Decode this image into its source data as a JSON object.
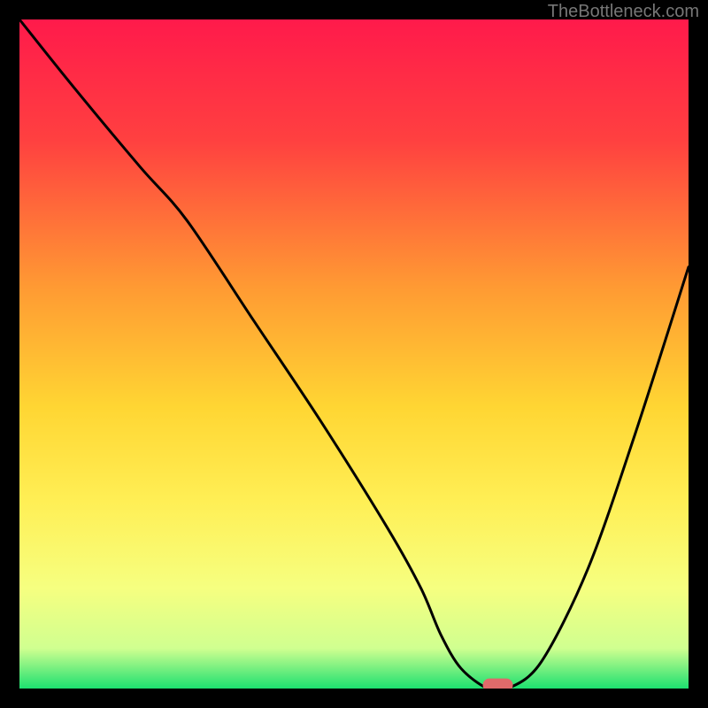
{
  "watermark": "TheBottleneck.com",
  "chart_data": {
    "type": "line",
    "title": "",
    "xlabel": "",
    "ylabel": "",
    "xlim": [
      0,
      100
    ],
    "ylim": [
      0,
      100
    ],
    "background_gradient": {
      "stops": [
        {
          "offset": 0,
          "color": "#ff1a4b"
        },
        {
          "offset": 18,
          "color": "#ff4040"
        },
        {
          "offset": 40,
          "color": "#ff9a33"
        },
        {
          "offset": 58,
          "color": "#ffd633"
        },
        {
          "offset": 72,
          "color": "#ffef55"
        },
        {
          "offset": 85,
          "color": "#f6ff80"
        },
        {
          "offset": 94,
          "color": "#d0ff90"
        },
        {
          "offset": 100,
          "color": "#1de070"
        }
      ]
    },
    "curve": {
      "x": [
        0,
        8,
        18,
        25,
        35,
        45,
        55,
        60,
        63,
        66,
        70,
        73,
        78,
        85,
        92,
        100
      ],
      "y": [
        100,
        90,
        78,
        70,
        55,
        40,
        24,
        15,
        8,
        3,
        0,
        0,
        4,
        18,
        38,
        63
      ]
    },
    "marker": {
      "x": 71.5,
      "y": 0.5,
      "width": 4.5,
      "height": 2.0,
      "color": "#e06a6a"
    }
  }
}
